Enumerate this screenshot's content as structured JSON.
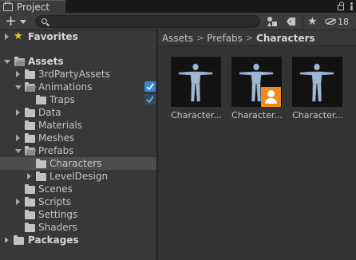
{
  "tab": {
    "title": "Project"
  },
  "toolbar": {
    "add_label": "+",
    "search": {
      "value": "",
      "placeholder": ""
    },
    "hidden_count": "18"
  },
  "tree": {
    "favorites": "Favorites",
    "assets": "Assets",
    "items": {
      "third_party": "3rdPartyAssets",
      "animations": "Animations",
      "traps": "Traps",
      "data": "Data",
      "materials": "Materials",
      "meshes": "Meshes",
      "prefabs": "Prefabs",
      "characters": "Characters",
      "level_design": "LevelDesign",
      "scenes": "Scenes",
      "scripts": "Scripts",
      "settings": "Settings",
      "shaders": "Shaders"
    },
    "packages": "Packages"
  },
  "breadcrumb": {
    "items": [
      "Assets",
      "Prefabs",
      "Characters"
    ],
    "separator": ">"
  },
  "assets": [
    {
      "label": "Character...",
      "badge": false
    },
    {
      "label": "Character...",
      "badge": true
    },
    {
      "label": "Character...",
      "badge": false
    }
  ],
  "colors": {
    "selection": "#4d4d4d",
    "checkbox": "#3a85d8",
    "badge": "#f18a1c",
    "star": "#f4c51f",
    "figure": "#9fb7d3"
  }
}
